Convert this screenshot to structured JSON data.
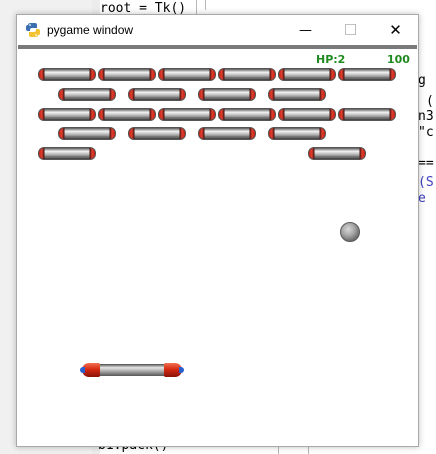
{
  "background_editor": {
    "lines": [
      {
        "text": "root = Tk()",
        "color": "#000000"
      },
      {
        "text": "g",
        "color": "#000000"
      },
      {
        "text": "(",
        "color": "#000000"
      },
      {
        "text": "n3",
        "color": "#000000"
      },
      {
        "text": "\"c",
        "color": "#000000"
      },
      {
        "text": "==",
        "color": "#000000"
      },
      {
        "text": "(S",
        "color": "#4040c0"
      },
      {
        "text": "e ",
        "color": "#4040c0"
      },
      {
        "text": "b1.pack()",
        "color": "#000000"
      }
    ]
  },
  "window": {
    "title": "pygame window",
    "minimize_symbol": "—",
    "maximize_symbol": "☐",
    "close_symbol": "✕",
    "app_icon": "pygame-snake-icon"
  },
  "hud": {
    "hp_label": "HP:2",
    "score": "100",
    "color": "#1f8a1f"
  },
  "game": {
    "brick_colors": {
      "end_caps": "#c41f12",
      "body": "#bdbdbd"
    },
    "brick_rows": [
      {
        "row": 1,
        "count": 6
      },
      {
        "row": 2,
        "count": 4
      },
      {
        "row": 3,
        "count": 6
      },
      {
        "row": 4,
        "count": 4
      },
      {
        "row": 5,
        "count": 2
      }
    ],
    "ball": "metal-ball",
    "paddle": "metal-paddle"
  }
}
